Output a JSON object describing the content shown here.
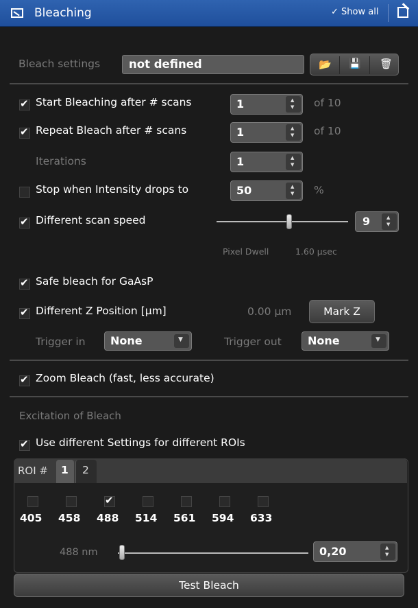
{
  "header": {
    "title": "Bleaching",
    "show_all": "✓ Show all"
  },
  "settings": {
    "label": "Bleach settings",
    "value": "not defined"
  },
  "start_bleaching": {
    "label": "Start Bleaching after # scans",
    "value": "1",
    "of": "of  10",
    "checked": true
  },
  "repeat_bleach": {
    "label": "Repeat Bleach after # scans",
    "value": "1",
    "of": "of  10",
    "checked": true
  },
  "iterations": {
    "label": "Iterations",
    "value": "1"
  },
  "stop_intensity": {
    "label": "Stop when Intensity drops to",
    "value": "50",
    "unit": "%",
    "checked": false
  },
  "scan_speed": {
    "label": "Different scan speed",
    "value": "9",
    "checked": true,
    "slider_fraction": 0.55
  },
  "pixel_dwell": {
    "label": "Pixel Dwell",
    "value": "1.60 µsec"
  },
  "safe_bleach": {
    "label": "Safe bleach for GaAsP",
    "checked": true
  },
  "z_position": {
    "label": "Different Z Position [µm]",
    "value": "0.00 µm",
    "button": "Mark Z",
    "checked": true
  },
  "trigger": {
    "in_label": "Trigger in",
    "in_value": "None",
    "out_label": "Trigger out",
    "out_value": "None"
  },
  "zoom_bleach": {
    "label": "Zoom Bleach (fast, less accurate)",
    "checked": true
  },
  "excitation": {
    "heading": "Excitation of Bleach",
    "different_rois": {
      "label": "Use different Settings for different ROIs",
      "checked": true
    },
    "roi_label": "ROI #",
    "roi_tabs": [
      "1",
      "2"
    ],
    "lasers": [
      {
        "wl": "405",
        "checked": false
      },
      {
        "wl": "458",
        "checked": false
      },
      {
        "wl": "488",
        "checked": true
      },
      {
        "wl": "514",
        "checked": false
      },
      {
        "wl": "561",
        "checked": false
      },
      {
        "wl": "594",
        "checked": false
      },
      {
        "wl": "633",
        "checked": false
      }
    ],
    "power_label": "488 nm",
    "power_value": "0,20",
    "power_slider_fraction": 0.02
  },
  "test_bleach": "Test Bleach"
}
